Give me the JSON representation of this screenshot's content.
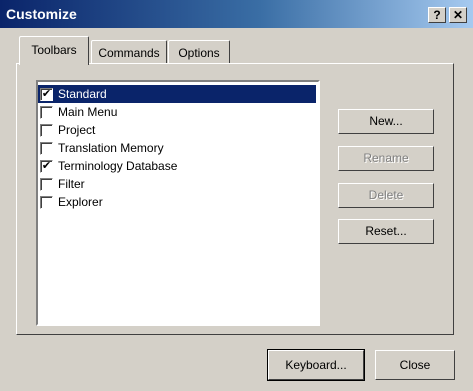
{
  "window": {
    "title": "Customize",
    "help_label": "?",
    "close_label": "✕"
  },
  "tabs": [
    {
      "label": "Toolbars",
      "active": true
    },
    {
      "label": "Commands",
      "active": false
    },
    {
      "label": "Options",
      "active": false
    }
  ],
  "toolbars": [
    {
      "label": "Standard",
      "checked": true,
      "selected": true
    },
    {
      "label": "Main Menu",
      "checked": false,
      "selected": false
    },
    {
      "label": "Project",
      "checked": false,
      "selected": false
    },
    {
      "label": "Translation Memory",
      "checked": false,
      "selected": false
    },
    {
      "label": "Terminology Database",
      "checked": true,
      "selected": false
    },
    {
      "label": "Filter",
      "checked": false,
      "selected": false
    },
    {
      "label": "Explorer",
      "checked": false,
      "selected": false
    }
  ],
  "buttons": {
    "new": "New...",
    "rename": "Rename",
    "delete": "Delete",
    "reset": "Reset...",
    "keyboard": "Keyboard...",
    "close": "Close"
  },
  "check_glyph": "✔"
}
